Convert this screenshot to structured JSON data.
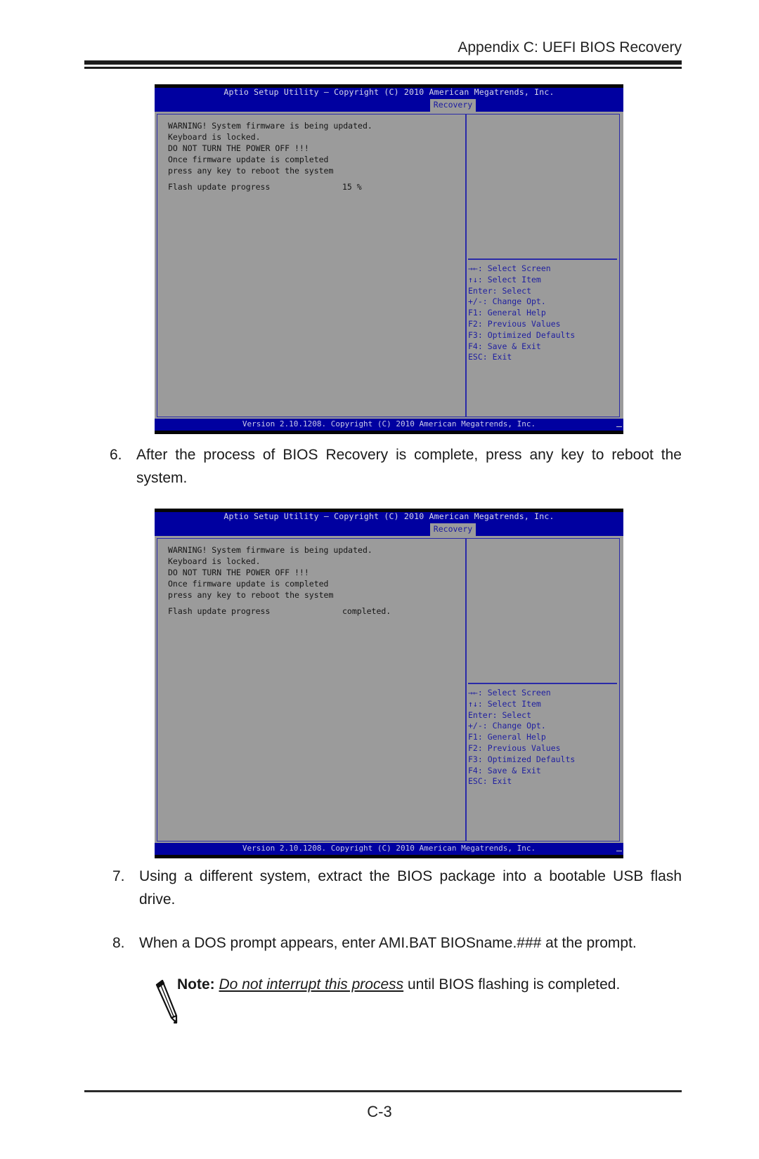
{
  "header": {
    "title": "Appendix C: UEFI BIOS Recovery"
  },
  "bios_screens": [
    {
      "title": "Aptio Setup Utility – Copyright (C) 2010 American Megatrends, Inc.",
      "tab": "Recovery",
      "message_lines": "WARNING! System firmware is being updated.\nKeyboard is locked.\nDO NOT TURN THE POWER OFF !!!\nOnce firmware update is completed\npress any key to reboot the system",
      "progress_label": "Flash update progress",
      "progress_value": "15 %",
      "progress_percent": 15,
      "help": "→←: Select Screen\n↑↓: Select Item\nEnter: Select\n+/-: Change Opt.\nF1: General Help\nF2: Previous Values\nF3: Optimized Defaults\nF4: Save & Exit\nESC: Exit",
      "footer": "Version 2.10.1208. Copyright (C) 2010 American Megatrends, Inc."
    },
    {
      "title": "Aptio Setup Utility – Copyright (C) 2010 American Megatrends, Inc.",
      "tab": "Recovery",
      "message_lines": "WARNING! System firmware is being updated.\nKeyboard is locked.\nDO NOT TURN THE POWER OFF !!!\nOnce firmware update is completed\npress any key to reboot the system",
      "progress_label": "Flash update progress",
      "progress_value": "completed.",
      "help": "→←: Select Screen\n↑↓: Select Item\nEnter: Select\n+/-: Change Opt.\nF1: General Help\nF2: Previous Values\nF3: Optimized Defaults\nF4: Save & Exit\nESC: Exit",
      "footer": "Version 2.10.1208. Copyright (C) 2010 American Megatrends, Inc."
    }
  ],
  "steps": [
    {
      "number": "6.",
      "text": "After the process of BIOS Recovery is complete, press any key to reboot the system."
    },
    {
      "number": "7.",
      "text": "Using a different system, extract the BIOS package into a bootable USB flash drive."
    },
    {
      "number": "8.",
      "text": "When a DOS prompt appears, enter AMI.BAT BIOSname.### at the prompt."
    }
  ],
  "note": {
    "label": "Note:",
    "emphasis": "Do not interrupt this process",
    "rest": " until BIOS flashing is completed.",
    "icon": "pencil-icon"
  },
  "footer": {
    "page_number": "C-3"
  }
}
